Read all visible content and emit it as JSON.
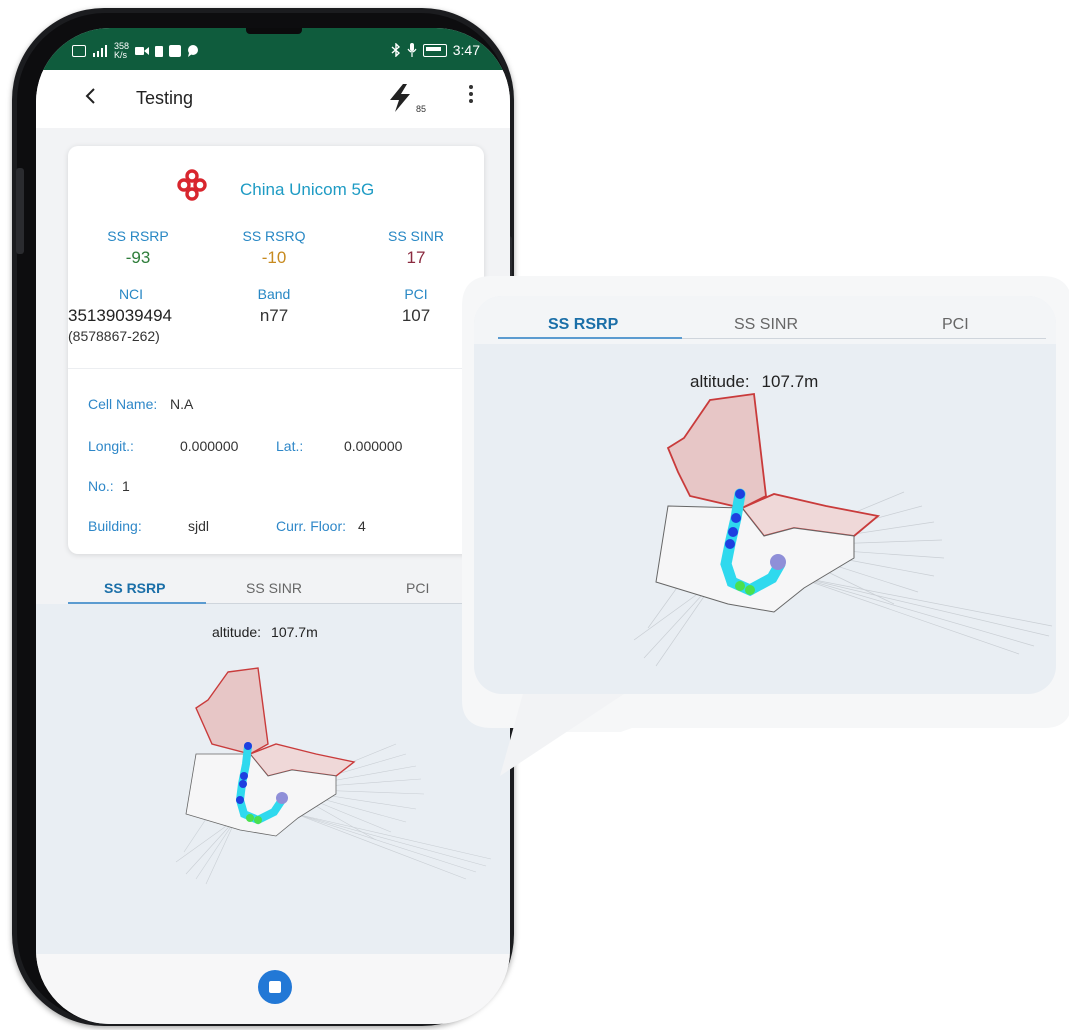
{
  "status_bar": {
    "network_speed": "358",
    "speed_unit": "K/s",
    "time": "3:47"
  },
  "app_bar": {
    "back_icon": "chevron-left-icon",
    "title": "Testing",
    "flash_icon": "lightning-icon",
    "flash_count": "85",
    "more_icon": "more-vertical-icon"
  },
  "operator": {
    "name": "China Unicom 5G",
    "logo_icon": "china-unicom-logo",
    "logo_color": "#d8262e"
  },
  "metrics": {
    "rsrp": {
      "label": "SS RSRP",
      "value": "-93",
      "color": "#2e7d3a"
    },
    "rsrq": {
      "label": "SS RSRQ",
      "value": "-10",
      "color": "#c78a1f"
    },
    "sinr": {
      "label": "SS SINR",
      "value": "17",
      "color": "#8b2a3f"
    },
    "nci": {
      "label": "NCI",
      "value": "35139039494",
      "sub": "(8578867-262)"
    },
    "band": {
      "label": "Band",
      "value": "n77"
    },
    "pci": {
      "label": "PCI",
      "value": "107"
    }
  },
  "cell_info": {
    "cell_name_label": "Cell Name:",
    "cell_name_value": "N.A",
    "longitude_label": "Longit.:",
    "longitude_value": "0.000000",
    "latitude_label": "Lat.:",
    "latitude_value": "0.000000",
    "number_label": "No.:",
    "number_value": "1",
    "building_label": "Building:",
    "building_value": "sjdl",
    "floor_label": "Curr. Floor:",
    "floor_value": "4"
  },
  "tabs": [
    {
      "label": "SS RSRP",
      "active": true
    },
    {
      "label": "SS SINR",
      "active": false
    },
    {
      "label": "PCI",
      "active": false
    }
  ],
  "map": {
    "altitude_label": "altitude:",
    "altitude_value": "107.7m"
  },
  "bottom": {
    "stop_icon": "stop-icon",
    "accent": "#2278d6"
  },
  "colors": {
    "status_bar": "#0f5c3d",
    "label_blue": "#2787c4",
    "operator_text": "#1e9bc4",
    "map_bg": "#e9eef3"
  }
}
